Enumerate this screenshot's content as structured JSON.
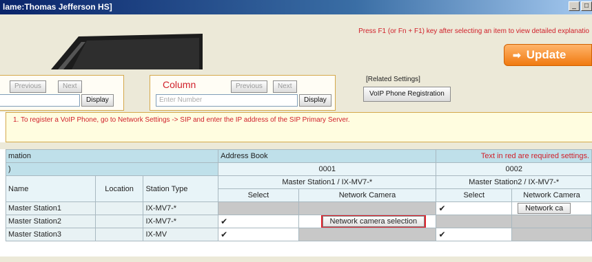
{
  "window": {
    "title": "lame:Thomas  Jefferson  HS]",
    "min_glyph": "_",
    "max_glyph": "□"
  },
  "header": {
    "f1_note": "Press F1 (or Fn + F1) key after selecting an item to view detailed explanatio",
    "update_label": "Update",
    "accent_color": "#f07a10"
  },
  "controls": {
    "left": {
      "previous": "Previous",
      "next": "Next",
      "display": "Display",
      "input_value": ""
    },
    "column": {
      "label": "Column",
      "previous": "Previous",
      "next": "Next",
      "placeholder": "Enter Number",
      "display": "Display"
    },
    "related": {
      "label": "[Related Settings]",
      "button": "VoIP Phone Registration"
    }
  },
  "notice": "1. To register a VoIP Phone, go to Network Settings -> SIP and enter the IP address of the SIP Primary Server.",
  "grid": {
    "left_header": "mation",
    "address_book": "Address Book",
    "required_note": "Text in red are required settings.",
    "col_ids": [
      "0001",
      "0002"
    ],
    "col_stations": [
      "Master Station1 / IX-MV7-*",
      "Master Station2 / IX-MV7-*"
    ],
    "col_headers": {
      "name": "Name",
      "location": "Location",
      "type": "Station Type",
      "select": "Select",
      "camera": "Network Camera"
    },
    "left_subheader": ")",
    "rows": [
      {
        "name": "Master Station1",
        "location": "",
        "type": "IX-MV7-*",
        "c1_select": "",
        "c1_camera": "",
        "c2_select": "✔",
        "c2_camera": "Network ca"
      },
      {
        "name": "Master Station2",
        "location": "",
        "type": "IX-MV7-*",
        "c1_select": "✔",
        "c1_camera": "Network camera selection",
        "c2_select": "",
        "c2_camera": ""
      },
      {
        "name": "Master Station3",
        "location": "",
        "type": "IX-MV",
        "c1_select": "✔",
        "c1_camera": "",
        "c2_select": "✔",
        "c2_camera": ""
      }
    ]
  }
}
